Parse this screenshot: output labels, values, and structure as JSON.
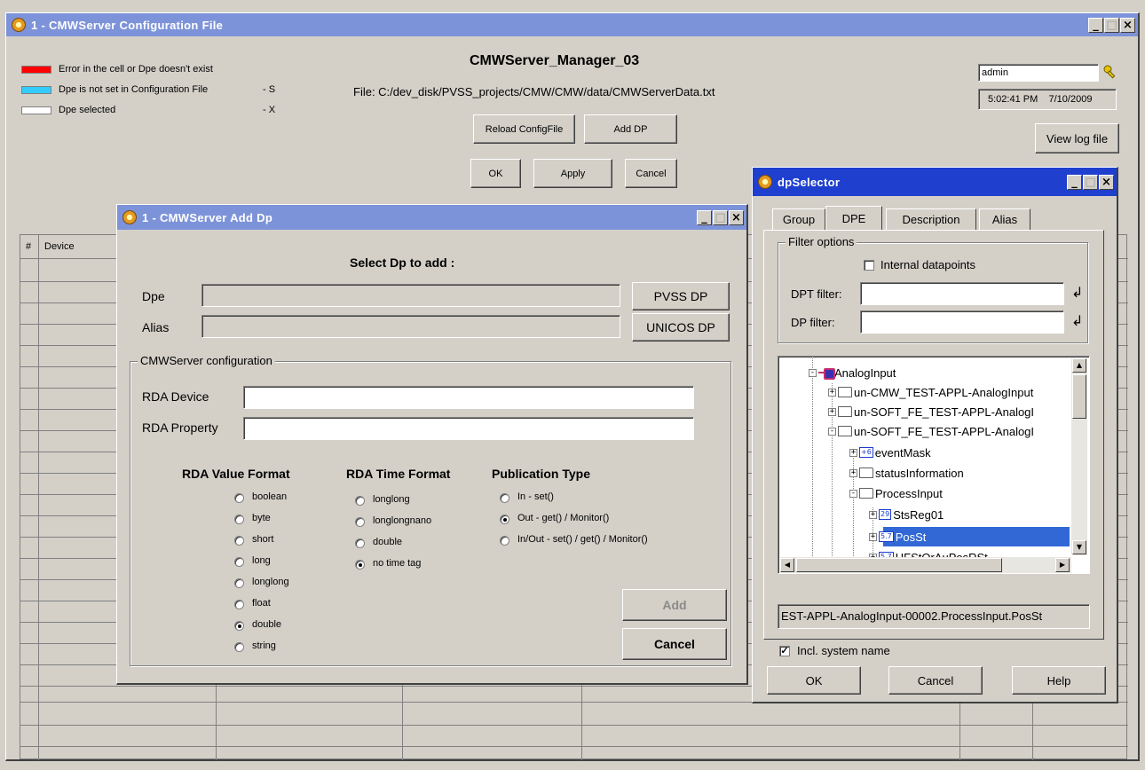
{
  "main_window": {
    "title": "1 - CMWServer Configuration File",
    "manager_title": "CMWServer_Manager_03",
    "file_path": "File: C:/dev_disk/PVSS_projects/CMW/CMW/data/CMWServerData.txt",
    "legend": [
      {
        "label": "Error in the cell or Dpe doesn't exist",
        "suffix": "",
        "color": "#ff0000"
      },
      {
        "label": "Dpe is not set in Configuration File",
        "suffix": "- S",
        "color": "#33ccff"
      },
      {
        "label": "Dpe selected",
        "suffix": "- X",
        "color": "#ffffff"
      }
    ],
    "buttons": {
      "reload": "Reload ConfigFile",
      "add_dp": "Add DP",
      "ok": "OK",
      "apply": "Apply",
      "cancel": "Cancel",
      "view_log": "View log file"
    },
    "user": "admin",
    "time": "5:02:41 PM",
    "date": "7/10/2009",
    "table_headers": [
      "#",
      "Device"
    ]
  },
  "add_dp": {
    "title": "1 - CMWServer Add Dp",
    "heading": "Select Dp to add :",
    "dpe_label": "Dpe",
    "alias_label": "Alias",
    "dpe_value": "",
    "alias_value": "",
    "pvss_button": "PVSS DP",
    "unicos_button": "UNICOS DP",
    "config_group": "CMWServer configuration",
    "rda_device_label": "RDA Device",
    "rda_property_label": "RDA Property",
    "rda_device_value": "",
    "rda_property_value": "",
    "value_format": {
      "title": "RDA Value Format",
      "options": [
        "boolean",
        "byte",
        "short",
        "long",
        "longlong",
        "float",
        "double",
        "string"
      ],
      "selected": "double"
    },
    "time_format": {
      "title": "RDA Time Format",
      "options": [
        "longlong",
        "longlongnano",
        "double",
        "no time tag"
      ],
      "selected": "no time tag"
    },
    "publication": {
      "title": "Publication Type",
      "options": [
        "In - set()",
        "Out - get() / Monitor()",
        "In/Out - set() / get() / Monitor()"
      ],
      "selected": "Out - get() / Monitor()"
    },
    "add_button": "Add",
    "cancel_button": "Cancel"
  },
  "dp_selector": {
    "title": "dpSelector",
    "tabs": [
      "Group",
      "DPE",
      "Description",
      "Alias"
    ],
    "active_tab": "DPE",
    "filter_group": "Filter options",
    "internal_dp_label": "Internal datapoints",
    "internal_dp_checked": false,
    "dpt_filter_label": "DPT filter:",
    "dp_filter_label": "DP filter:",
    "dpt_filter_value": "",
    "dp_filter_value": "",
    "tree": [
      {
        "text": "AnalogInput",
        "type": "dpt"
      },
      {
        "text": "un-CMW_TEST-APPL-AnalogInput",
        "type": "folder"
      },
      {
        "text": "un-SOFT_FE_TEST-APPL-AnalogI",
        "type": "folder"
      },
      {
        "text": "un-SOFT_FE_TEST-APPL-AnalogI",
        "type": "folder"
      },
      {
        "text": "eventMask",
        "type": "badge",
        "badge": "+6"
      },
      {
        "text": "statusInformation",
        "type": "folder"
      },
      {
        "text": "ProcessInput",
        "type": "folder"
      },
      {
        "text": "StsReg01",
        "type": "badge",
        "badge": "29"
      },
      {
        "text": "PosSt",
        "type": "badge",
        "badge": "5.7",
        "selected": true
      },
      {
        "text": "HFStOrAuPosRSt",
        "type": "badge",
        "badge": "5.7"
      }
    ],
    "selected_path": "EST-APPL-AnalogInput-00002.ProcessInput.PosSt",
    "incl_system_label": "Incl. system name",
    "incl_system_checked": true,
    "ok_button": "OK",
    "cancel_button": "Cancel",
    "help_button": "Help"
  },
  "colors": {
    "title_inactive": "#7d93d9",
    "title_active": "#1f3fcf",
    "selection": "#3168d5",
    "window_bg": "#d4d0c8"
  }
}
